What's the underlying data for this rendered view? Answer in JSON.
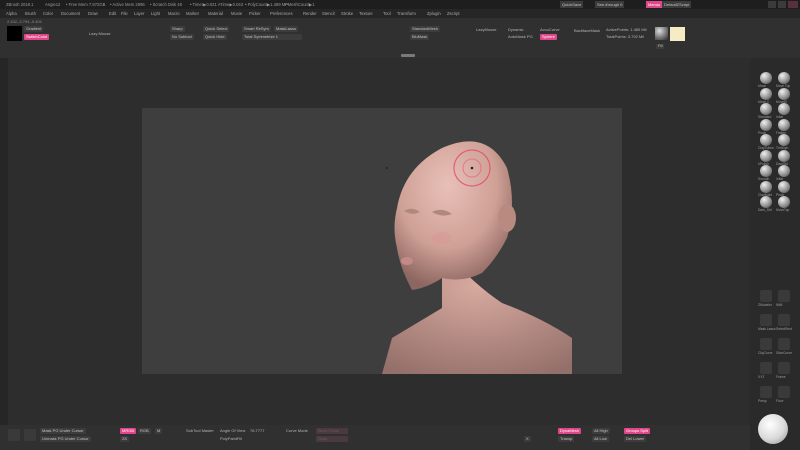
{
  "titlebar": {
    "app": "ZBrush 2018.1",
    "project": "Angie12",
    "free_mem": "• Free Mem 7.872GB",
    "active_mem": "• Active Mem 2896",
    "scratch": "• Scratch Disk 48",
    "timer": "• Timer▶0.021 ATime▶0.043",
    "polycount": "• PolyCount▶1.489 MP",
    "meshcount": "• MeshCount▶1",
    "quicksave": "QuickSave",
    "seethrough": "See-through  0",
    "menus": "Menus",
    "default_script": "DefaultZScript"
  },
  "menubar": [
    "Alpha",
    "Brush",
    "Color",
    "Document",
    "Draw",
    "Edit",
    "File",
    "Layer",
    "Light",
    "Macro",
    "Marker",
    "Material",
    "Movie",
    "Picker",
    "Preferences",
    "Render",
    "Stencil",
    "Stroke",
    "Texture",
    "Tool",
    "Transform",
    "Zplugin",
    "Zscript"
  ],
  "shelf": {
    "coords": "2.432,-2.794,-0.401",
    "gradient": "Gradient",
    "switch_color": "SwitchColor",
    "alternate": "Alternate",
    "lazy_mouse": "Lazy Mouse",
    "draw_size_label": "Draw Size",
    "draw_size_value": "64",
    "focal_shift": "Focal Shift 0",
    "z_intensity": "Z Intensity 25",
    "rgb_intensity": "Rgb Intensity",
    "rgb": "Rgb",
    "m": "M",
    "mrgb": "Mrgb",
    "zadd": "Zadd",
    "zsub": "Zsub",
    "zcut": "Zcut",
    "sharp": "Sharp",
    "quick_select": "Quick Select",
    "smart_resym": "Smart ReSym",
    "mask_lasso": "MaskLasso",
    "no_subtool": "No Subtool",
    "quick_hide": "Quick Hide",
    "total_symmetrize": "Total Symmetrize 1",
    "standard_mesh": "StandardMesh",
    "lazy_mouse2": "LazyMouse",
    "dynamic": "Dynamic",
    "active_points": "ActivePoints: 1.489 Mil",
    "total_points": "TotalPoints: 3.792 Mil",
    "backface_mask": "BackfaceMask",
    "auto_mask_pg": "AutoMask PG",
    "accucurve": "AccuCurve",
    "sphere": "Sphere",
    "bluemask": "BluMask",
    "fill_label": "Fill",
    "mat_label": "MatCap"
  },
  "right_shelf": {
    "items": [
      "Move",
      "Move Top",
      "Move C",
      "MoveEl",
      "Standard",
      "Inflat",
      "Pinch",
      "Flatten",
      "ClayTubes",
      "TrimDyn",
      "hPolish",
      "DamStd",
      "Smooth",
      "Inflat",
      "ClayBuild",
      "Pinch",
      "Dam_Std",
      "MoveTop"
    ],
    "labels_lower": [
      "ZModeler",
      "IMM",
      "Mask Lasso",
      "SelectRect",
      "ClipCurve",
      "SliceCurve",
      "XYZ",
      "Frame",
      "Persp",
      "Floor"
    ]
  },
  "bottom": {
    "mask_pg": "Mask PG Under Cursor",
    "unmask_pg": "Unmask PG Under Cursor",
    "mrgb": "MRGB",
    "rgb": "RGB",
    "m": "M",
    "zadd": "ZAdd",
    "zsub": "ZSub",
    "zsub_small": "Z8",
    "single_layer": "Single Layer",
    "double_layer": "Double",
    "angle_of_view": "Angle Of View",
    "angle_value": "76.7777",
    "subtool_master": "SubTool Master",
    "polypainter": "PolyPaintFill",
    "curve_mode": "Curve Mode",
    "bend_curve": "Bend Curve",
    "snap": "Snap",
    "poly_frame": "PolyF",
    "transp": "Transp",
    "all_high": "All High",
    "dynamesh": "DynaMesh",
    "all_low": "All Low",
    "groups_split": "Groups Split",
    "del_lower": "Del Lower",
    "x_sym": "X",
    "ghost": "Ghost"
  }
}
